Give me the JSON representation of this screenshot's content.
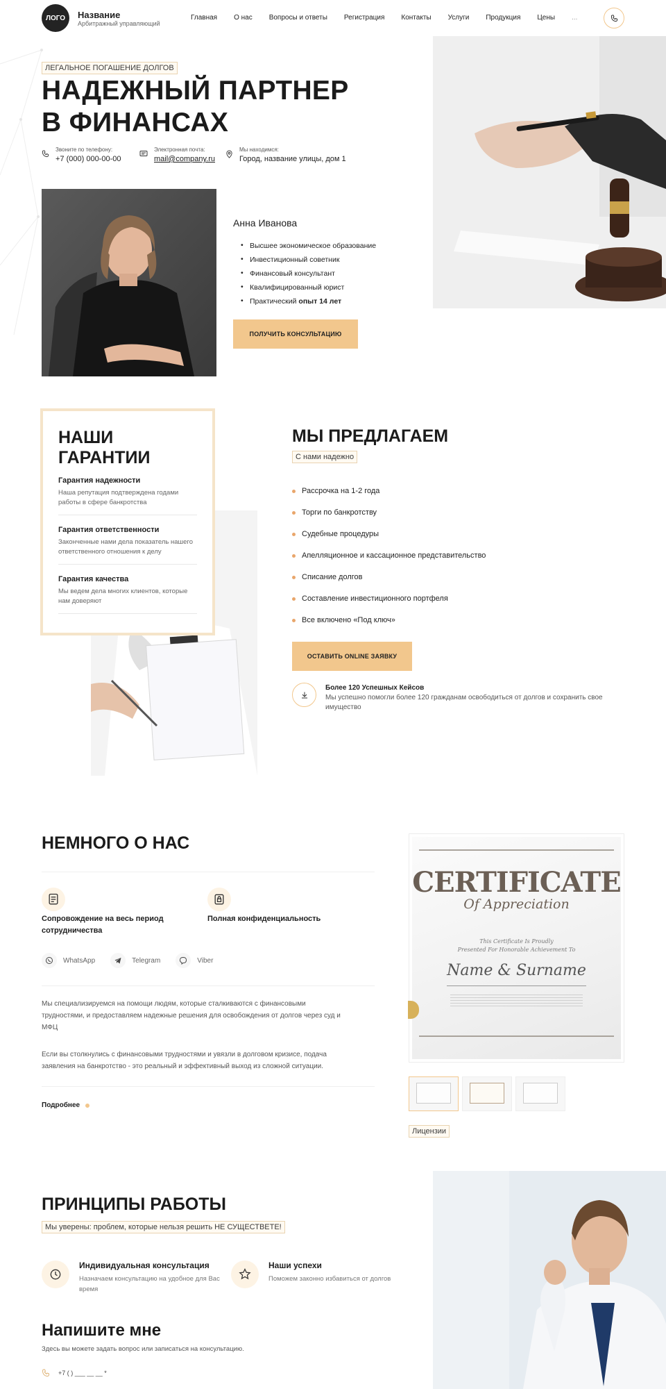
{
  "header": {
    "logo_text": "ЛОГО",
    "brand_name": "Название",
    "brand_sub": "Арбитражный управляющий",
    "nav": [
      "Главная",
      "О нас",
      "Вопросы и ответы",
      "Регистрация",
      "Контакты",
      "Услуги",
      "Продукция",
      "Цены",
      "..."
    ],
    "phone_icon": "phone-icon"
  },
  "hero": {
    "badge": "ЛЕГАЛЬНОЕ ПОГАШЕНИЕ ДОЛГОВ",
    "title_line1": "НАДЕЖНЫЙ ПАРТНЕР",
    "title_line2": "В ФИНАНСАХ",
    "contacts": [
      {
        "label": "Звоните по телефону:",
        "value": "+7 (000) 000-00-00",
        "icon": "phone-icon"
      },
      {
        "label": "Электронная почта:",
        "value": "mail@company.ru",
        "icon": "mail-icon"
      },
      {
        "label": "Мы находимся:",
        "value": "Город, название улицы, дом 1",
        "icon": "location-icon"
      }
    ],
    "person_name": "Анна Иванова",
    "qualifications": [
      "Высшее экономическое образование",
      "Инвестиционный советник",
      "Финансовый консультант",
      "Квалифицированный юрист"
    ],
    "experience_prefix": "Практический ",
    "experience_bold": "опыт 14 лет",
    "cta": "ПОЛУЧИТЬ КОНСУЛЬТАЦИЮ"
  },
  "guarantees": {
    "title_line1": "НАШИ",
    "title_line2": "ГАРАНТИИ",
    "items": [
      {
        "title": "Гарантия надежности",
        "text": "Наша репутация подтверждена годами работы в сфере банкротства"
      },
      {
        "title": "Гарантия ответственности",
        "text": "Законченные нами дела показатель нашего ответственного отношения к делу"
      },
      {
        "title": "Гарантия качества",
        "text": "Мы ведем дела многих клиентов, которые нам доверяют"
      }
    ]
  },
  "offer": {
    "title": "МЫ ПРЕДЛАГАЕМ",
    "badge": "С нами надежно",
    "items": [
      "Рассрочка на 1-2 года",
      "Торги по банкротству",
      "Судебные процедуры",
      "Апелляционное и кассационное представительство",
      "Списание долгов",
      "Составление инвестиционного портфеля",
      "Все включено «Под ключ»"
    ],
    "cta": "ОСТАВИТЬ ONLINE ЗАЯВКУ",
    "cases_title": "Более 120 Успешных Кейсов",
    "cases_text": "Мы успешно помогли более 120 гражданам освободиться от долгов и сохранить свое имущество"
  },
  "about": {
    "title": "НЕМНОГО О НАС",
    "features": [
      {
        "text": "Сопровождение на весь период сотрудничества",
        "icon": "document-icon"
      },
      {
        "text": "Полная конфиденциальность",
        "icon": "lock-icon"
      }
    ],
    "socials": [
      "WhatsApp",
      "Telegram",
      "Viber"
    ],
    "paragraph1": "Мы специализируемся на помощи людям, которые сталкиваются с финансовыми трудностями, и предоставляем надежные решения для освобождения от долгов через суд и МФЦ",
    "paragraph2": "Если вы столкнулись с финансовыми трудностями и увязли в долговом кризисе, подача заявления на банкротство - это реальный и эффективный выход из сложной ситуации.",
    "more": "Подробнее",
    "certificate": {
      "title": "CERTIFICATE",
      "subtitle": "Of Appreciation",
      "line1": "This Certificate Is Proudly",
      "line2": "Presented For Honorable Achievement To",
      "name": "Name & Surname"
    },
    "licenses_label": "Лицензии"
  },
  "principles": {
    "title": "ПРИНЦИПЫ РАБОТЫ",
    "badge": "Мы уверены: проблем, которые нельзя решить НЕ СУЩЕСТВЕТЕ!",
    "items": [
      {
        "title": "Индивидуальная консультация",
        "text": "Назначаем консультацию на удобное для Вас время",
        "icon": "clock-icon"
      },
      {
        "title": "Наши успехи",
        "text": "Поможем законно избавиться от долгов",
        "icon": "star-icon"
      }
    ]
  },
  "contact_form": {
    "title": "Напишите мне",
    "text": "Здесь вы можете задать вопрос или записаться на консультацию.",
    "phone_placeholder": "+7 (   ) ___ __ __ *"
  },
  "colors": {
    "accent": "#f2c78d",
    "text": "#1f1f1f"
  }
}
